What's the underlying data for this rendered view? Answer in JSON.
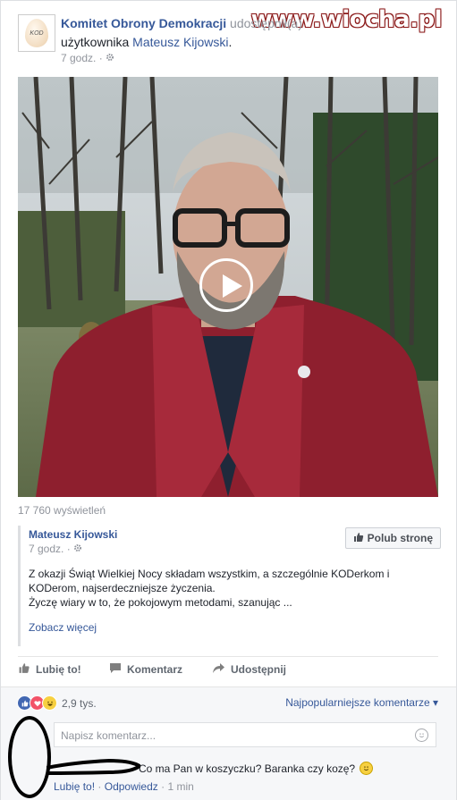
{
  "watermark": "www.wiocha.pl",
  "post": {
    "page_name": "Komitet Obrony Demokracji",
    "shared_text": "udostępnił(a)",
    "line2_prefix": "użytkownika",
    "line2_user": "Mateusz Kijowski",
    "line2_suffix": ".",
    "time": "7 godz.",
    "meta_sep": "·",
    "avatar_label": "KOD",
    "views": "17 760 wyświetleń"
  },
  "shared_post": {
    "author": "Mateusz Kijowski",
    "time": "7 godz.",
    "meta_sep": "·",
    "like_page_label": "Polub stronę",
    "line1": "Z okazji Świąt Wielkiej Nocy składam wszystkim, a szczególnie KODerkom i",
    "line2": "KODerom, najserdeczniejsze życzenia.",
    "line3": "Życzę wiary w to, że pokojowym metodami, szanując ...",
    "see_more": "Zobacz więcej"
  },
  "actions": {
    "like": "Lubię to!",
    "comment": "Komentarz",
    "share": "Udostępnij"
  },
  "reactions": {
    "count": "2,9 tys.",
    "sort_label": "Najpopularniejsze komentarze",
    "sort_caret": "▾"
  },
  "comment_box": {
    "placeholder": "Napisz komentarz..."
  },
  "comment": {
    "text": "Co ma Pan w koszyczku? Baranka czy kozę?",
    "like": "Lubię to!",
    "sep1": "·",
    "reply": "Odpowiedz",
    "sep2": "·",
    "time": "1 min"
  },
  "icons": {
    "settings": "gear-icon",
    "play": "play-icon",
    "thumb": "thumbs-up-icon",
    "comment": "comment-icon",
    "share": "share-icon",
    "smiley": "smiley-icon"
  },
  "colors": {
    "link": "#365899",
    "like_blue": "#4267b2",
    "love_red": "#f25268",
    "haha_yellow": "#f7d041"
  }
}
